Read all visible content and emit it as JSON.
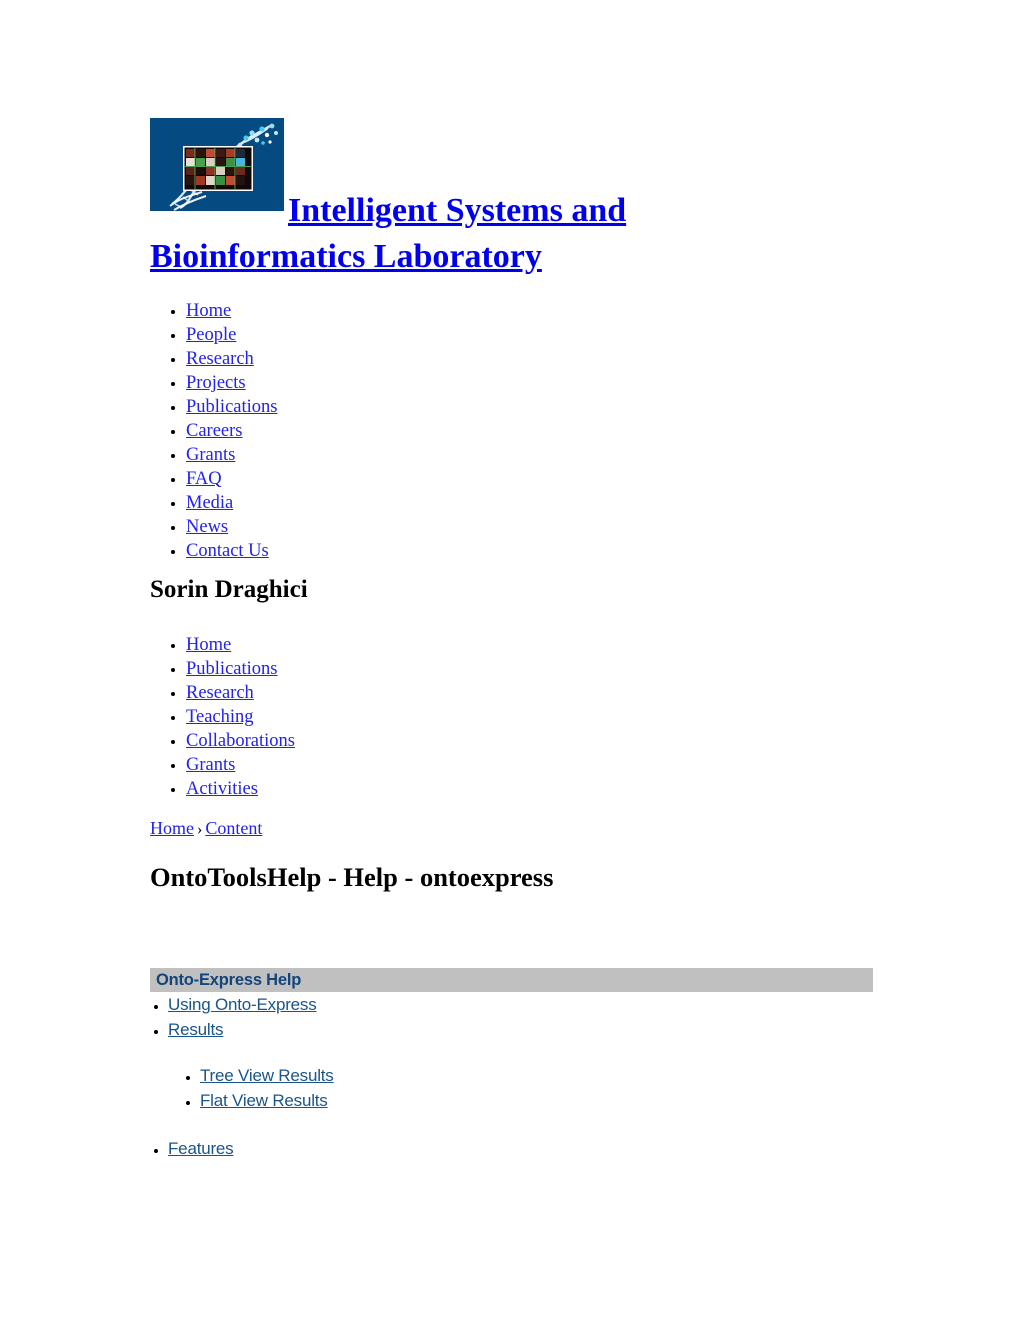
{
  "site": {
    "logo_alt": "microarray-dna-helix-logo",
    "logo_bg_color": "#054a80",
    "title_line1": "Intelligent Systems and ",
    "title_line2": "Bioinformatics Laboratory ",
    "title_color": "#0000ee"
  },
  "main_nav": {
    "items": [
      {
        "label": "Home"
      },
      {
        "label": "People"
      },
      {
        "label": "Research"
      },
      {
        "label": "Projects"
      },
      {
        "label": "Publications"
      },
      {
        "label": "Careers"
      },
      {
        "label": "Grants"
      },
      {
        "label": "FAQ"
      },
      {
        "label": "Media"
      },
      {
        "label": "News"
      },
      {
        "label": "Contact Us"
      }
    ]
  },
  "person": {
    "name": "Sorin Draghici",
    "nav": {
      "items": [
        {
          "label": "Home"
        },
        {
          "label": "Publications"
        },
        {
          "label": "Research"
        },
        {
          "label": "Teaching"
        },
        {
          "label": "Collaborations"
        },
        {
          "label": "Grants"
        },
        {
          "label": "Activities"
        }
      ]
    }
  },
  "breadcrumb": {
    "items": [
      {
        "label": "Home"
      },
      {
        "label": "Content"
      }
    ],
    "separator": "›"
  },
  "page": {
    "title": "OntoToolsHelp - Help - ontoexpress"
  },
  "help": {
    "bar_label": "Onto-Express Help",
    "bar_bg_color": "#c0c0c0",
    "bar_text_color": "#13447a",
    "link_color": "#19558a",
    "items": [
      {
        "label": "Using Onto-Express"
      },
      {
        "label": "Results"
      }
    ],
    "sub_items": [
      {
        "label": "Tree View Results"
      },
      {
        "label": "Flat View Results"
      }
    ],
    "trailing_items": [
      {
        "label": "Features"
      }
    ]
  }
}
